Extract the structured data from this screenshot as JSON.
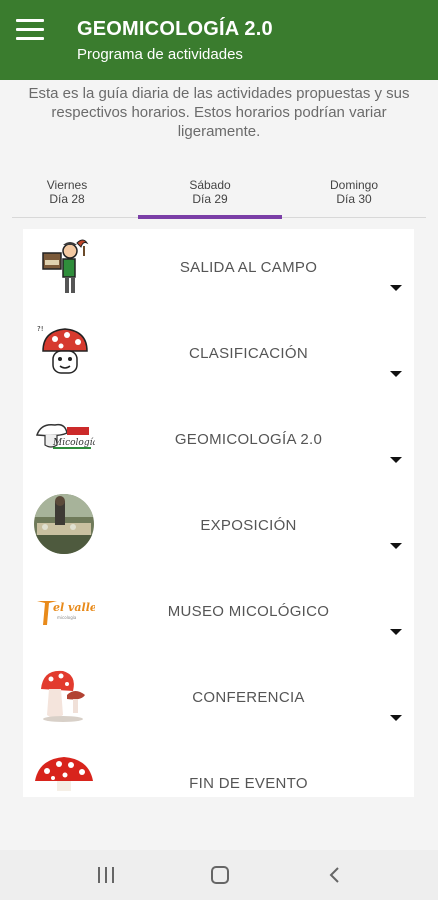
{
  "appbar": {
    "title": "GEOMICOLOGÍA 2.0",
    "subtitle": "Programa de actividades",
    "color": "#3a7c2e"
  },
  "intro": {
    "text": "Esta es la guía diaria de las actividades propuestas y sus respectivos horarios. Estos horarios podrían variar ligeramente."
  },
  "tabs": [
    {
      "day": "Viernes",
      "date": "Día 28",
      "active": false
    },
    {
      "day": "Sábado",
      "date": "Día 29",
      "active": true
    },
    {
      "day": "Domingo",
      "date": "Día 30",
      "active": false
    }
  ],
  "accent": "#7b3fa7",
  "activities": [
    {
      "label": "SALIDA AL CAMPO",
      "icon": "hiker-icon"
    },
    {
      "label": "CLASIFICACIÓN",
      "icon": "mushroom-character-icon"
    },
    {
      "label": "GEOMICOLOGÍA 2.0",
      "icon": "micologia-logo-icon"
    },
    {
      "label": "EXPOSICIÓN",
      "icon": "exhibition-photo-icon"
    },
    {
      "label": "MUSEO MICOLÓGICO",
      "icon": "el-valle-logo-icon"
    },
    {
      "label": "CONFERENCIA",
      "icon": "red-mushrooms-icon"
    },
    {
      "label": "FIN DE EVENTO",
      "icon": "amanita-icon"
    }
  ],
  "navbar": {
    "icons": [
      "recents-icon",
      "home-icon",
      "back-icon"
    ]
  }
}
